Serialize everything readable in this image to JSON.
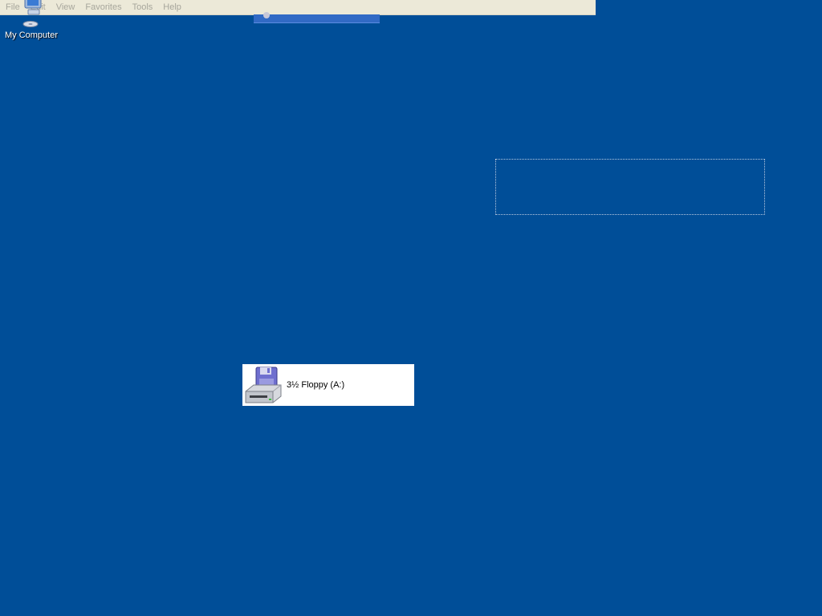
{
  "menubar": {
    "items": [
      "File",
      "Edit",
      "View",
      "Favorites",
      "Tools",
      "Help"
    ]
  },
  "desktop_icons": {
    "my_computer": {
      "label": "My Computer",
      "icon": "my-computer-icon"
    }
  },
  "drag_item": {
    "label": "3½ Floppy (A:)",
    "icon": "floppy-drive-icon"
  },
  "colors": {
    "desktop_background": "#004e98",
    "menubar_background": "#ece9d8",
    "menu_text_disabled": "#a7a69c",
    "selection_highlight": "#316ac5"
  }
}
